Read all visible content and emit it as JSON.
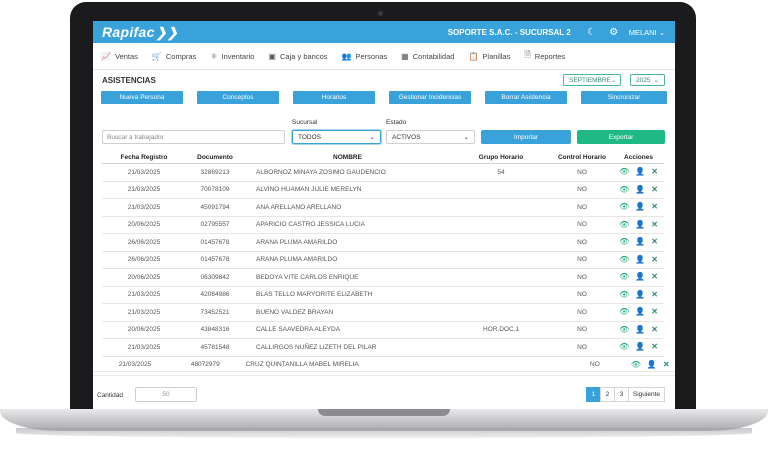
{
  "topbar": {
    "logo": "Rapifac",
    "company": "SOPORTE S.A.C. - SUCURSAL 2",
    "user": "MELANI",
    "moon_icon": "moon-icon",
    "gear_icon": "gear-icon"
  },
  "menu": [
    {
      "label": "Ventas",
      "icon": "chart-icon"
    },
    {
      "label": "Compras",
      "icon": "cart-icon"
    },
    {
      "label": "Inventario",
      "icon": "boxes-icon"
    },
    {
      "label": "Caja y bancos",
      "icon": "cash-icon"
    },
    {
      "label": "Personas",
      "icon": "people-icon"
    },
    {
      "label": "Contabilidad",
      "icon": "calculator-icon"
    },
    {
      "label": "Planillas",
      "icon": "clipboard-icon"
    },
    {
      "label": "Reportes",
      "icon": "file-icon"
    }
  ],
  "page": {
    "title": "ASISTENCIAS",
    "month": "SEPTIEMBRE",
    "year": "2025"
  },
  "buttons": [
    "Nueva Persona",
    "Conceptos",
    "Horarios",
    "Gestionar Incidencias",
    "Borrar Asistencia",
    "Sincronizar"
  ],
  "filters": {
    "search_placeholder": "Buscar a trabajador",
    "sucursal_label": "Sucursal",
    "sucursal_value": "TODOS",
    "estado_label": "Estado",
    "estado_value": "ACTIVOS",
    "import_label": "Importar",
    "export_label": "Exportar"
  },
  "table": {
    "headers": [
      "Fecha Registro",
      "Documento",
      "Nombre",
      "Grupo Horario",
      "Control Horario",
      "Acciones"
    ],
    "rows": [
      [
        "21/03/2025",
        "32869213",
        "ALBORNOZ MINAYA ZOSIMO GAUDENCIO",
        "54",
        "NO"
      ],
      [
        "21/03/2025",
        "70078109",
        "ALVINO HUAMAN JULIE MERELYN",
        "",
        "NO"
      ],
      [
        "21/03/2025",
        "45091794",
        "ANA ARELLANO ARELLANO",
        "",
        "NO"
      ],
      [
        "20/06/2025",
        "02795557",
        "APARICIO CASTRO JESSICA LUCIA",
        "",
        "NO"
      ],
      [
        "26/06/2025",
        "01457678",
        "ARANA PLUMA AMARILDO",
        "",
        "NO"
      ],
      [
        "26/06/2025",
        "01457678",
        "ARANA PLUMA AMARILDO",
        "",
        "NO"
      ],
      [
        "20/06/2025",
        "06309842",
        "BEDOYA VITE CARLOS ENRIQUE",
        "",
        "NO"
      ],
      [
        "21/03/2025",
        "42084986",
        "BLAS TELLO MARYORITE ELIZABETH",
        "",
        "NO"
      ],
      [
        "21/03/2025",
        "73452521",
        "BUENO VALDEZ BRAYAN",
        "",
        "NO"
      ],
      [
        "20/06/2025",
        "43848316",
        "CALLE SAAVEDRA ALEYDA",
        "HOR.DOC.1",
        "NO"
      ],
      [
        "21/03/2025",
        "45781548",
        "CALLIRGOS NUÑEZ LIZETH DEL PILAR",
        "",
        "NO"
      ]
    ],
    "last_row": [
      "21/03/2025",
      "48072979",
      "CRUZ QUINTANILLA MABEL MIRELIA",
      "",
      "NO"
    ]
  },
  "footer": {
    "quantity_label": "Cantidad",
    "quantity_value": "50",
    "pages": [
      "1",
      "2",
      "3"
    ],
    "next_label": "Siguiente"
  }
}
